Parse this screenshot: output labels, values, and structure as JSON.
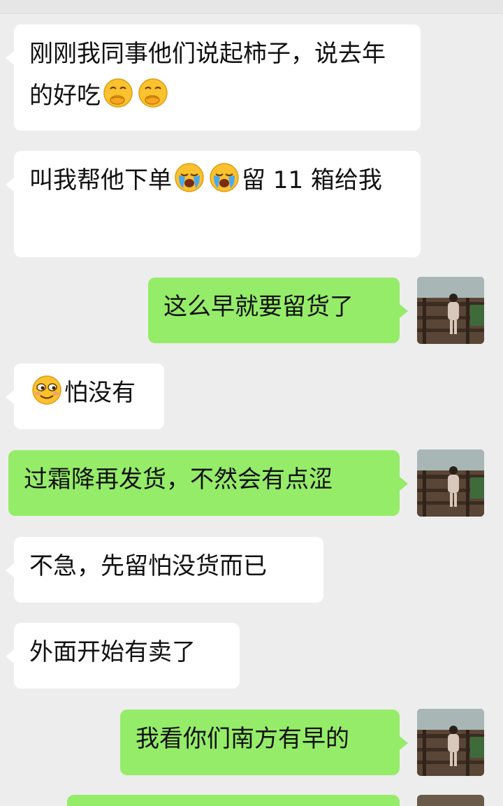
{
  "messages": [
    {
      "id": "m1",
      "side": "incoming",
      "text_a": "刚刚我同事他们说起柿子，说去年的好吃",
      "emojis": [
        "face-with-hand-over-mouth",
        "face-with-hand-over-mouth"
      ]
    },
    {
      "id": "m2",
      "side": "incoming",
      "text_a": "叫我帮他下单",
      "emojis": [
        "loudly-crying-face",
        "loudly-crying-face"
      ],
      "text_b": "留 11 箱给我"
    },
    {
      "id": "m3",
      "side": "outgoing",
      "text": "这么早就要留货了"
    },
    {
      "id": "m4",
      "side": "incoming",
      "emoji": "relieved-smirk-face",
      "text": "怕没有"
    },
    {
      "id": "m5",
      "side": "outgoing",
      "text": "过霜降再发货，不然会有点涩"
    },
    {
      "id": "m6",
      "side": "incoming",
      "text": "不急，先留怕没货而已"
    },
    {
      "id": "m7",
      "side": "incoming",
      "text": "外面开始有卖了"
    },
    {
      "id": "m8",
      "side": "outgoing",
      "text": "我看你们南方有早的"
    }
  ],
  "colors": {
    "background": "#ededed",
    "incoming_bubble": "#ffffff",
    "outgoing_bubble": "#95ec69"
  },
  "icons": {
    "self_avatar": "avatar-photo-child-on-wooden-bridge"
  }
}
